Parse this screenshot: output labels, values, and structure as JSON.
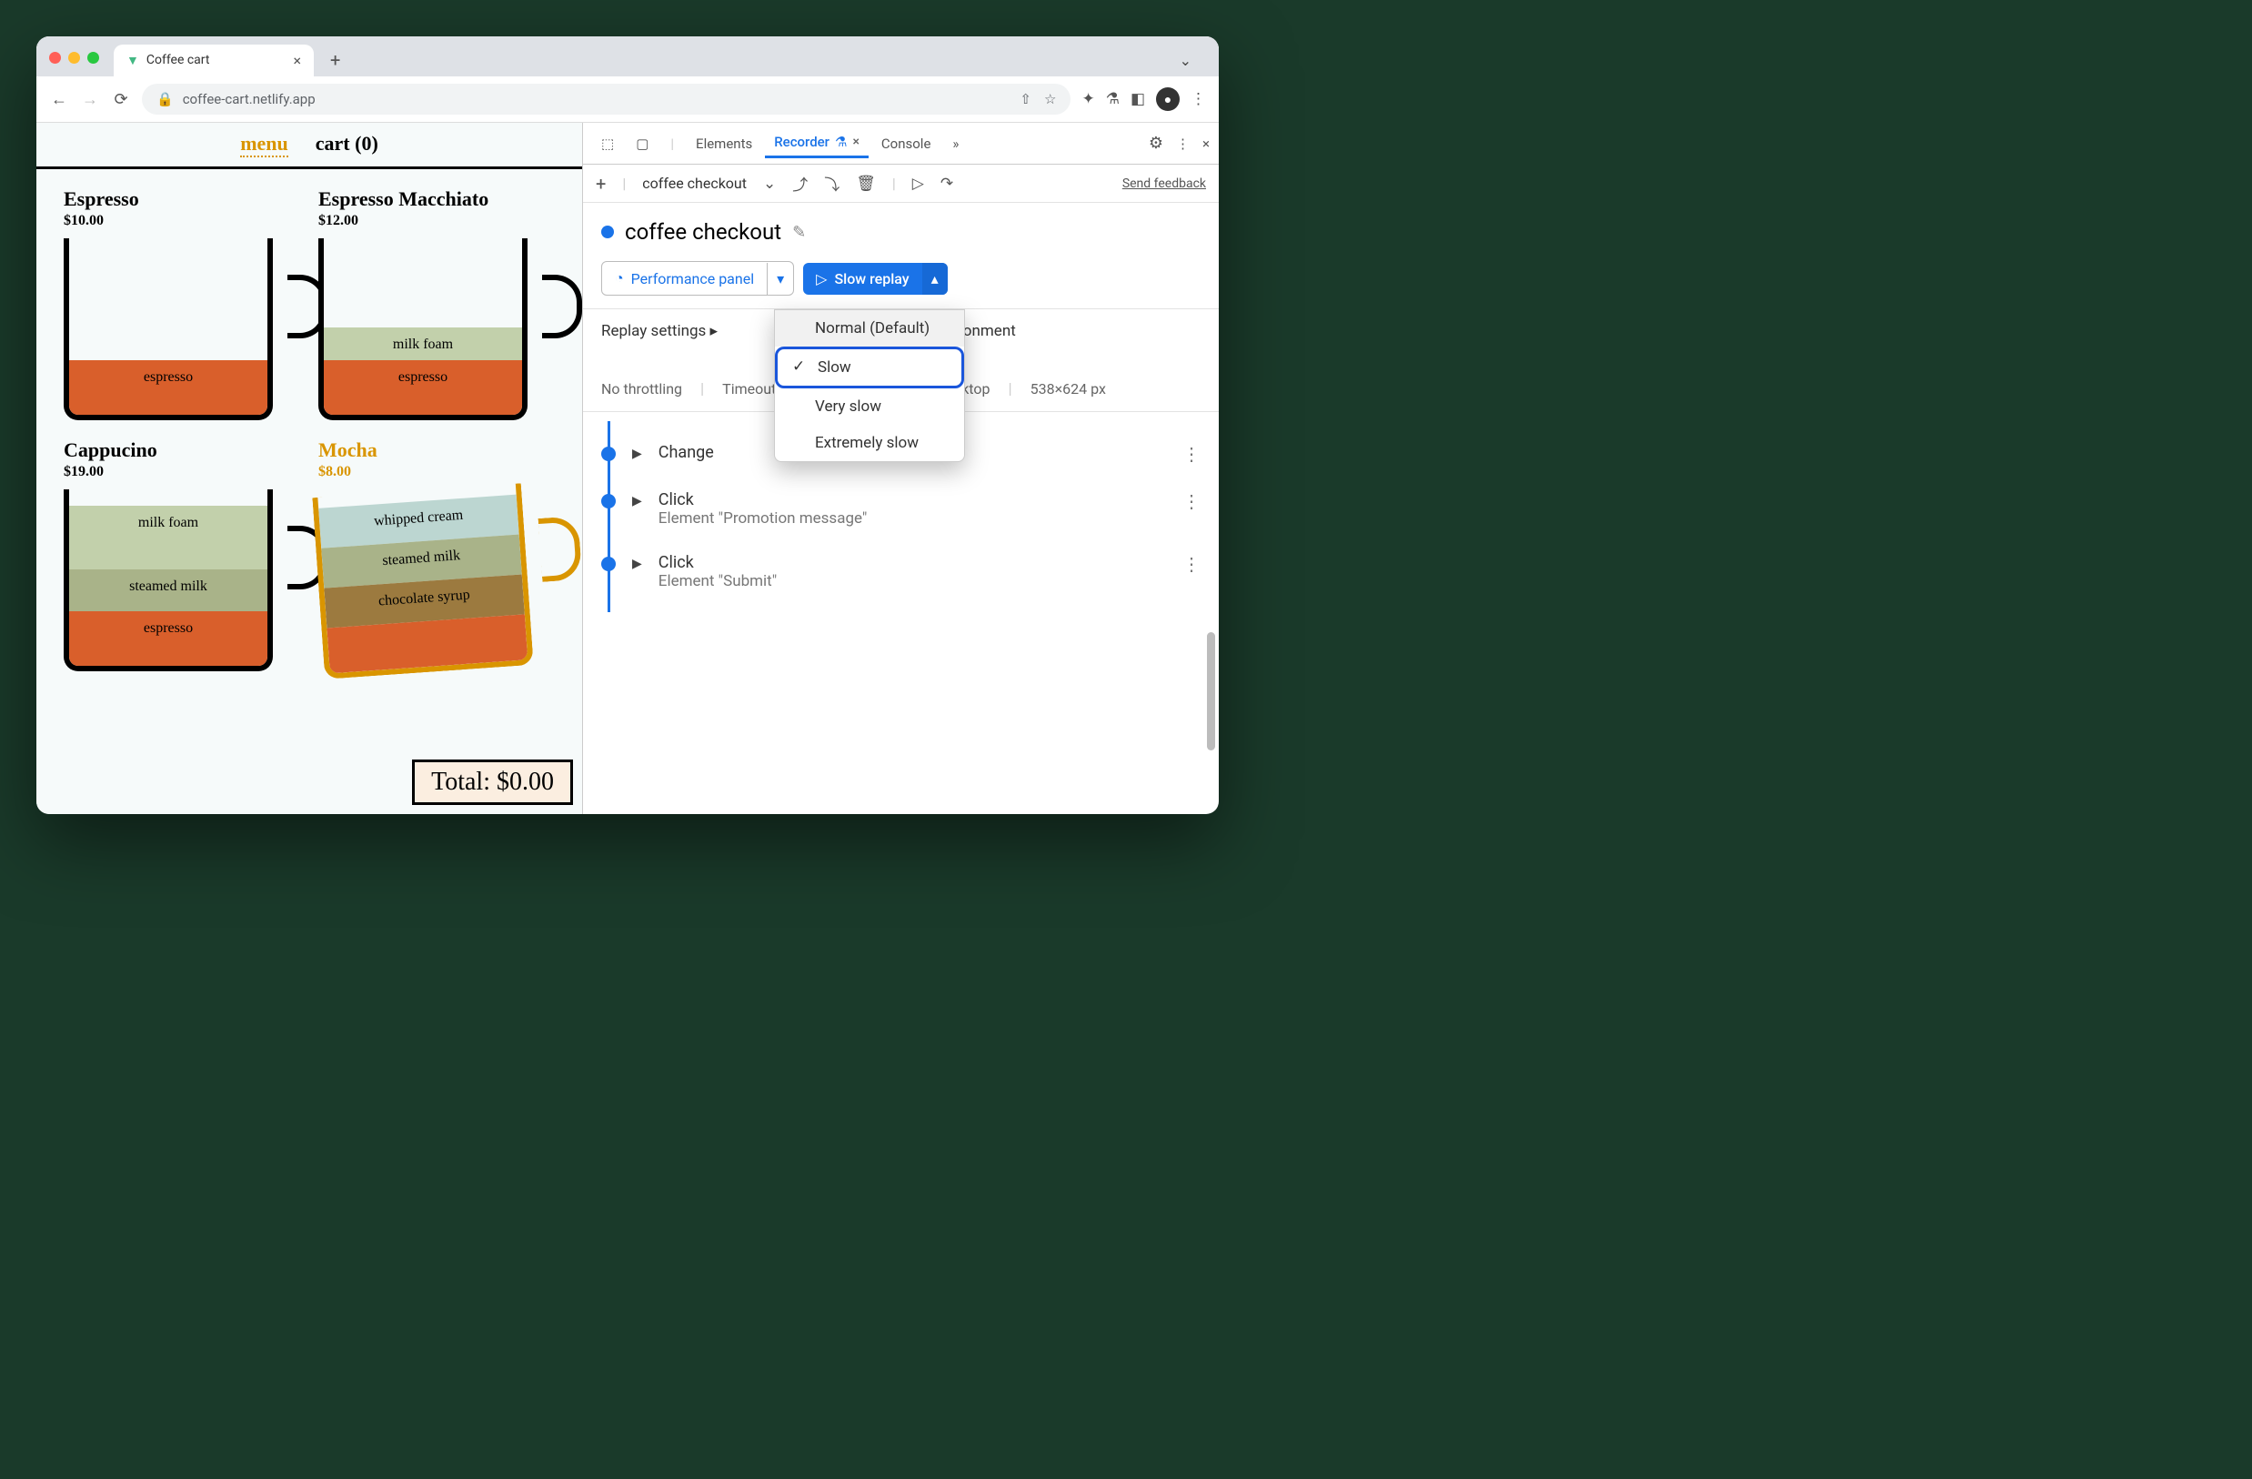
{
  "browser": {
    "tab_title": "Coffee cart",
    "url": "coffee-cart.netlify.app"
  },
  "page": {
    "nav": {
      "menu": "menu",
      "cart": "cart (0)"
    },
    "products": [
      {
        "name": "Espresso",
        "price": "$10.00",
        "layers": [
          {
            "cls": "l-espresso",
            "label": "espresso",
            "h": 60
          }
        ]
      },
      {
        "name": "Espresso Macchiato",
        "price": "$12.00",
        "layers": [
          {
            "cls": "l-milkfoam",
            "label": "milk foam",
            "h": 36
          },
          {
            "cls": "l-espresso",
            "label": "espresso",
            "h": 60
          }
        ]
      },
      {
        "name": "Cappucino",
        "price": "$19.00",
        "layers": [
          {
            "cls": "l-milkfoam",
            "label": "milk foam",
            "h": 70
          },
          {
            "cls": "l-steamed",
            "label": "steamed milk",
            "h": 46
          },
          {
            "cls": "l-espresso",
            "label": "espresso",
            "h": 60
          }
        ]
      },
      {
        "name": "Mocha",
        "price": "$8.00",
        "mocha": true,
        "layers": [
          {
            "cls": "l-cream",
            "label": "whipped cream",
            "h": 44
          },
          {
            "cls": "l-steamed",
            "label": "steamed milk",
            "h": 44
          },
          {
            "cls": "l-choc",
            "label": "chocolate syrup",
            "h": 44
          },
          {
            "cls": "l-espresso",
            "label": "",
            "h": 50
          }
        ]
      }
    ],
    "total": "Total: $0.00"
  },
  "devtools": {
    "tabs": {
      "elements": "Elements",
      "recorder": "Recorder",
      "console": "Console"
    },
    "recording_name": "coffee checkout",
    "feedback": "Send feedback",
    "title": "coffee checkout",
    "perf_panel": "Performance panel",
    "slow_replay": "Slow replay",
    "replay_speeds": {
      "normal": "Normal (Default)",
      "slow": "Slow",
      "very_slow": "Very slow",
      "extremely_slow": "Extremely slow"
    },
    "settings": {
      "label": "Replay settings",
      "throttling": "No throttling",
      "timeout_label": "Timeout:",
      "env_label": "ironment",
      "device": "ktop",
      "viewport": "538×624 px"
    },
    "steps": [
      {
        "title": "Change",
        "sub": ""
      },
      {
        "title": "Click",
        "sub": "Element \"Promotion message\""
      },
      {
        "title": "Click",
        "sub": "Element \"Submit\""
      }
    ]
  }
}
